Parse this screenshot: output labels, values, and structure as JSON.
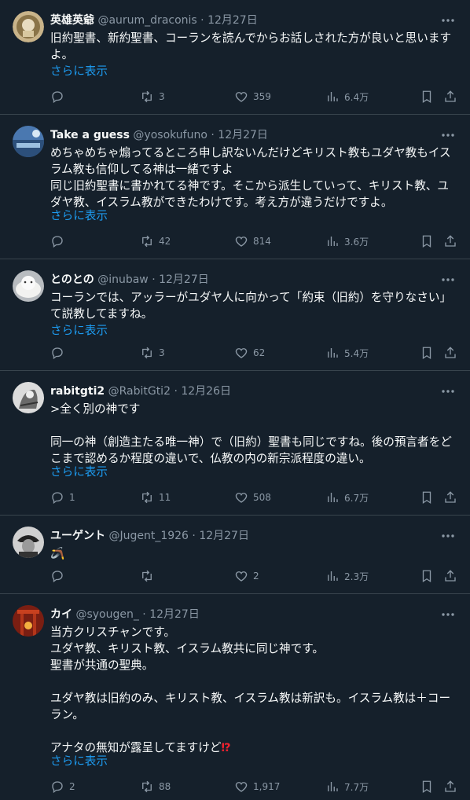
{
  "tweets": [
    {
      "name": "英雄英爺",
      "handle": "@aurum_draconis",
      "date": "12月27日",
      "text": "旧約聖書、新約聖書、コーランを読んでからお話しされた方が良いと思いますよ。",
      "show_more": "さらに表示",
      "replies": "",
      "retweets": "3",
      "likes": "359",
      "views": "6.4万"
    },
    {
      "name": "Take a guess",
      "handle": "@yosokufuno",
      "date": "12月27日",
      "text": "めちゃめちゃ煽ってるところ申し訳ないんだけどキリスト教もユダヤ教もイスラム教も信仰してる神は一緒ですよ\n同じ旧約聖書に書かれてる神です。そこから派生していって、キリスト教、ユダヤ教、イスラム教ができたわけです。考え方が違うだけですよ。",
      "show_more": "さらに表示",
      "replies": "",
      "retweets": "42",
      "likes": "814",
      "views": "3.6万"
    },
    {
      "name": "とのとの",
      "handle": "@inubaw",
      "date": "12月27日",
      "text": "コーランでは、アッラーがユダヤ人に向かって「約束（旧約）を守りなさい」て説教してますね。",
      "show_more": "さらに表示",
      "replies": "",
      "retweets": "3",
      "likes": "62",
      "views": "5.4万"
    },
    {
      "name": "rabitgti2",
      "handle": "@RabitGti2",
      "date": "12月26日",
      "text": ">全く別の神です\n\n同一の神（創造主たる唯一神）で（旧約）聖書も同じですね。後の預言者をどこまで認めるか程度の違いで、仏教の内の新宗派程度の違い。",
      "show_more": "さらに表示",
      "replies": "1",
      "retweets": "11",
      "likes": "508",
      "views": "6.7万"
    },
    {
      "name": "ユーゲント",
      "handle": "@Jugent_1926",
      "date": "12月27日",
      "text": "🪃",
      "show_more": "",
      "replies": "",
      "retweets": "",
      "likes": "2",
      "views": "2.3万"
    },
    {
      "name": "カイ",
      "handle": "@syougen_",
      "date": "12月27日",
      "text": "当方クリスチャンです。\nユダヤ教、キリスト教、イスラム教共に同じ神です。\n聖書が共通の聖典。\n\nユダヤ教は旧約のみ、キリスト教、イスラム教は新訳も。イスラム教は＋コーラン。\n\nアナタの無知が露呈してますけど",
      "emoji_suffix": "⁉",
      "show_more": "さらに表示",
      "replies": "2",
      "retweets": "88",
      "likes": "1,917",
      "views": "7.7万"
    }
  ]
}
